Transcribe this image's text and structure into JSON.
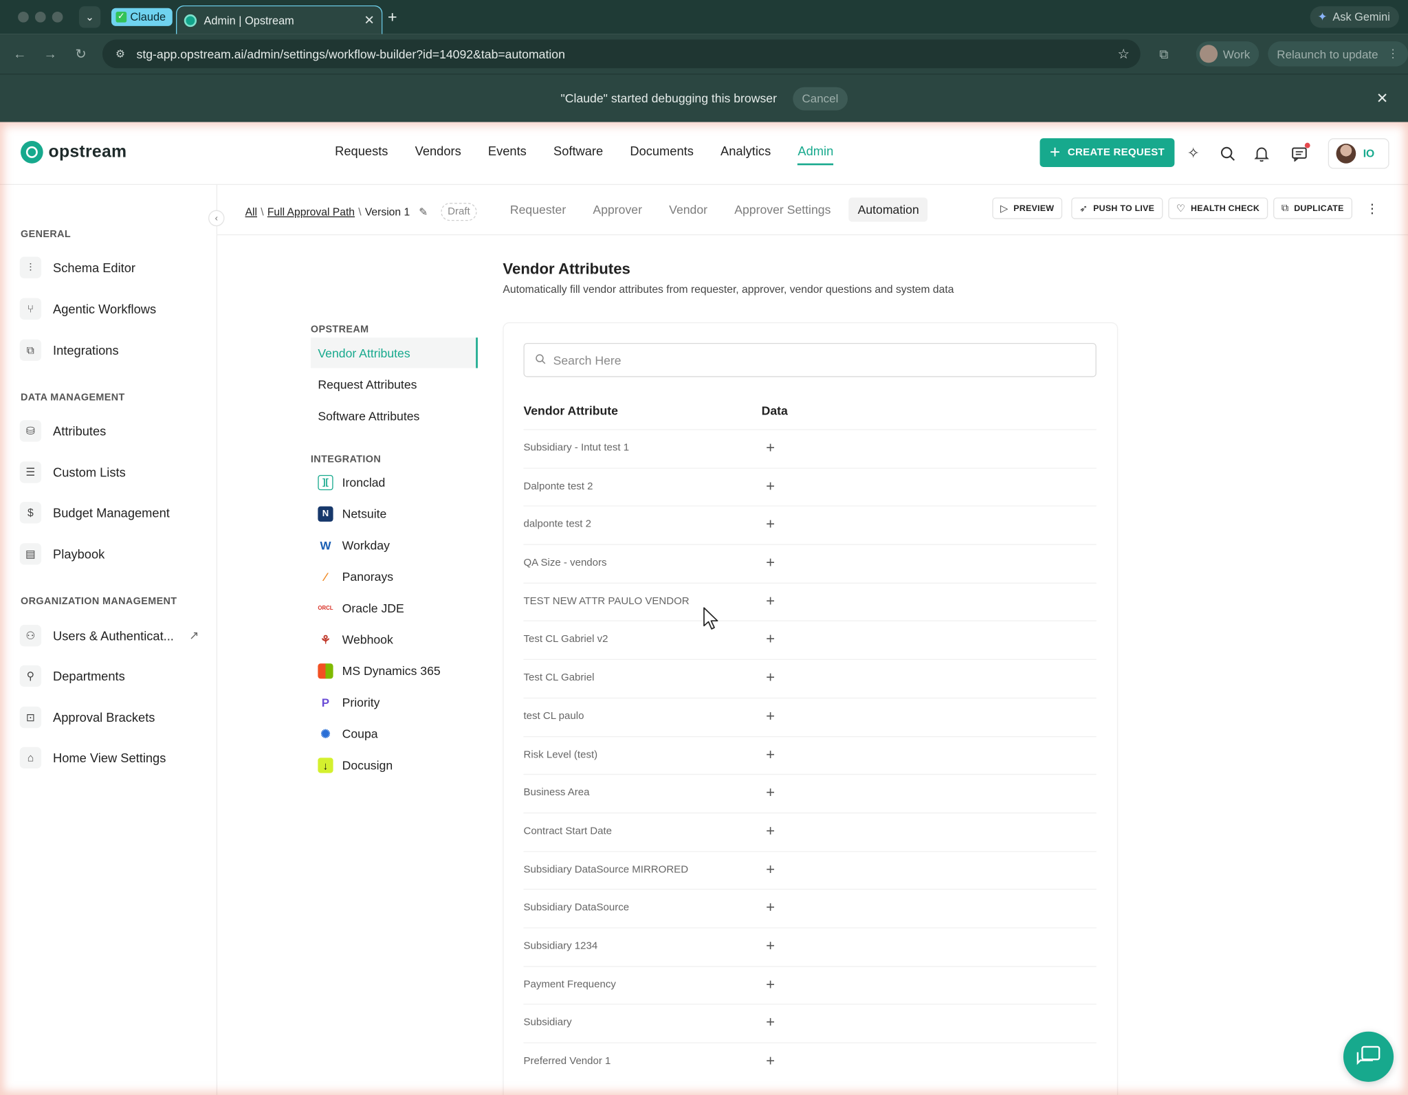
{
  "browser": {
    "claude_chip": "Claude",
    "tab_title": "Admin | Opstream",
    "tab_close": "✕",
    "new_tab": "+",
    "ask_gemini": "Ask Gemini",
    "url": "stg-app.opstream.ai/admin/settings/workflow-builder?id=14092&tab=automation",
    "profile": "Work",
    "relaunch": "Relaunch to update",
    "debug_message": "\"Claude\" started debugging this browser",
    "debug_cancel": "Cancel"
  },
  "app": {
    "logo": "opstream",
    "nav": [
      "Requests",
      "Vendors",
      "Events",
      "Software",
      "Documents",
      "Analytics",
      "Admin"
    ],
    "active_nav": "Admin",
    "create_request": "CREATE REQUEST",
    "avatar_mark": "IO",
    "accent": "#17a98d"
  },
  "sidebar": {
    "sections": [
      {
        "title": "GENERAL",
        "items": [
          "Schema Editor",
          "Agentic Workflows",
          "Integrations"
        ]
      },
      {
        "title": "DATA MANAGEMENT",
        "items": [
          "Attributes",
          "Custom Lists",
          "Budget Management",
          "Playbook"
        ]
      },
      {
        "title": "ORGANIZATION MANAGEMENT",
        "items": [
          "Users & Authenticat...",
          "Departments",
          "Approval Brackets",
          "Home View Settings"
        ]
      }
    ]
  },
  "subheader": {
    "breadcrumb": {
      "all": "All",
      "sep": "\\",
      "path": "Full Approval Path",
      "version": "Version 1"
    },
    "status": "Draft",
    "tabs": [
      "Requester",
      "Approver",
      "Vendor",
      "Approver Settings",
      "Automation"
    ],
    "active_tab": "Automation",
    "actions": [
      "PREVIEW",
      "PUSH TO LIVE",
      "HEALTH CHECK",
      "DUPLICATE"
    ]
  },
  "content": {
    "title": "Vendor Attributes",
    "subtitle": "Automatically fill vendor attributes from requester, approver, vendor questions and system data",
    "inner_nav": {
      "opstream_title": "OPSTREAM",
      "opstream_items": [
        "Vendor Attributes",
        "Request Attributes",
        "Software Attributes"
      ],
      "integration_title": "INTEGRATION",
      "integrations": [
        "Ironclad",
        "Netsuite",
        "Workday",
        "Panorays",
        "Oracle JDE",
        "Webhook",
        "MS Dynamics 365",
        "Priority",
        "Coupa",
        "Docusign"
      ]
    },
    "search_placeholder": "Search Here",
    "columns": [
      "Vendor Attribute",
      "Data"
    ],
    "rows": [
      "Subsidiary - Intut test 1",
      "Dalponte test 2",
      "dalponte test 2",
      "QA Size - vendors",
      "TEST NEW ATTR PAULO VENDOR",
      "Test CL Gabriel v2",
      "Test CL Gabriel",
      "test CL paulo",
      "Risk Level (test)",
      "Business Area",
      "Contract Start Date",
      "Subsidiary DataSource MIRRORED",
      "Subsidiary DataSource",
      "Subsidiary 1234",
      "Payment Frequency",
      "Subsidiary",
      "Preferred Vendor 1"
    ],
    "add_symbol": "+"
  }
}
